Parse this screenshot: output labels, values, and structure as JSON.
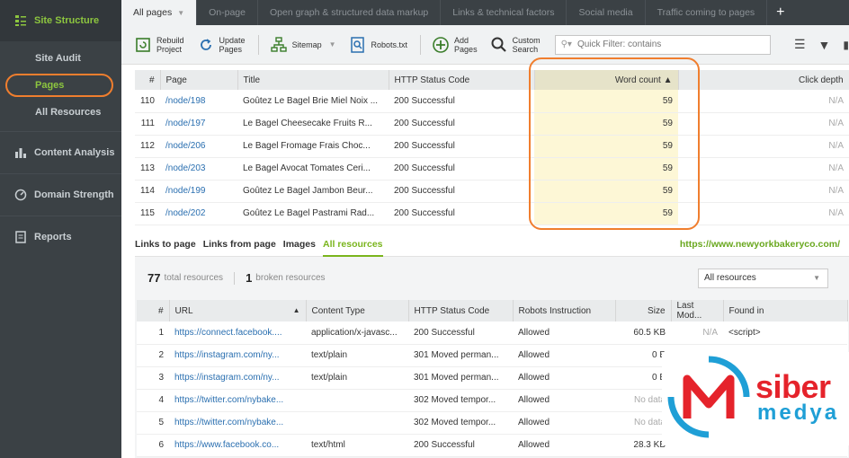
{
  "sidebar": {
    "header": "Site Structure",
    "subitems": [
      "Site Audit",
      "Pages",
      "All Resources"
    ],
    "sections": [
      "Content Analysis",
      "Domain Strength",
      "Reports"
    ]
  },
  "tabs": [
    "All pages",
    "On-page",
    "Open graph & structured data markup",
    "Links & technical factors",
    "Social media",
    "Traffic coming to pages"
  ],
  "toolbar": {
    "rebuild": [
      "Rebuild",
      "Project"
    ],
    "update": [
      "Update",
      "Pages"
    ],
    "sitemap": "Sitemap",
    "robots": "Robots.txt",
    "add": [
      "Add",
      "Pages"
    ],
    "custom": [
      "Custom",
      "Search"
    ],
    "filter_placeholder": "Quick Filter: contains"
  },
  "pages_table": {
    "headers": [
      "#",
      "Page",
      "Title",
      "HTTP Status Code",
      "Word count ▲",
      "Click depth"
    ],
    "rows": [
      [
        "110",
        "/node/198",
        "Goûtez Le Bagel Brie Miel Noix ...",
        "200 Successful",
        "59",
        "N/A"
      ],
      [
        "111",
        "/node/197",
        "Le Bagel Cheesecake Fruits R...",
        "200 Successful",
        "59",
        "N/A"
      ],
      [
        "112",
        "/node/206",
        "Le Bagel Fromage Frais Choc...",
        "200 Successful",
        "59",
        "N/A"
      ],
      [
        "113",
        "/node/203",
        "Le Bagel Avocat Tomates Ceri...",
        "200 Successful",
        "59",
        "N/A"
      ],
      [
        "114",
        "/node/199",
        "Goûtez Le Bagel Jambon Beur...",
        "200 Successful",
        "59",
        "N/A"
      ],
      [
        "115",
        "/node/202",
        "Goûtez Le Bagel Pastrami Rad...",
        "200 Successful",
        "59",
        "N/A"
      ]
    ]
  },
  "bottom": {
    "tabs": [
      "Links to page",
      "Links from page",
      "Images",
      "All resources"
    ],
    "site": "https://www.newyorkbakeryco.com/",
    "total_count": "77",
    "total_label": "total resources",
    "broken_count": "1",
    "broken_label": "broken resources",
    "select_value": "All resources",
    "headers": [
      "#",
      "URL",
      "Content Type",
      "HTTP Status Code",
      "Robots Instruction",
      "Size",
      "Last Mod...",
      "Found in"
    ],
    "rows": [
      [
        "1",
        "https://connect.facebook....",
        "application/x-javasc...",
        "200 Successful",
        "Allowed",
        "60.5 KB",
        "N/A",
        "<script>"
      ],
      [
        "2",
        "https://instagram.com/ny...",
        "text/plain",
        "301 Moved perman...",
        "Allowed",
        "0 B",
        "",
        ""
      ],
      [
        "3",
        "https://instagram.com/ny...",
        "text/plain",
        "301 Moved perman...",
        "Allowed",
        "0 B",
        "",
        ""
      ],
      [
        "4",
        "https://twitter.com/nybake...",
        "",
        "302 Moved tempor...",
        "Allowed",
        "No data",
        "",
        ""
      ],
      [
        "5",
        "https://twitter.com/nybake...",
        "",
        "302 Moved tempor...",
        "Allowed",
        "No data",
        "",
        ""
      ],
      [
        "6",
        "https://www.facebook.co...",
        "text/html",
        "200 Successful",
        "Allowed",
        "28.3 KB",
        "",
        ""
      ]
    ]
  },
  "logo": {
    "line1": "siber",
    "line2": "medya"
  },
  "colors": {
    "accent_green": "#8dc63f",
    "highlight_orange": "#f07e2e",
    "sidebar_bg": "#3b4145"
  }
}
